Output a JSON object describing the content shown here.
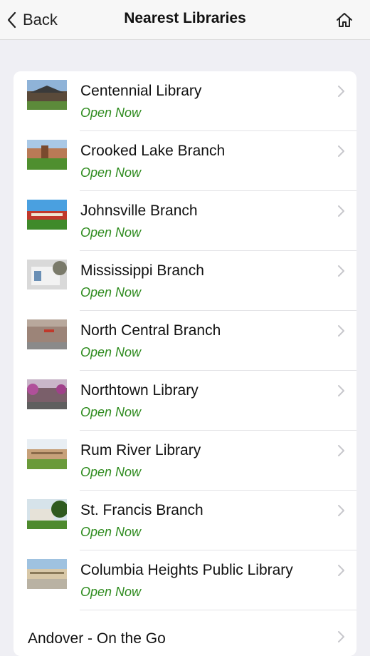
{
  "nav": {
    "back_label": "Back",
    "title": "Nearest Libraries",
    "home_icon": "home-icon"
  },
  "libraries": [
    {
      "name": "Centennial Library",
      "status": "Open Now"
    },
    {
      "name": "Crooked Lake Branch",
      "status": "Open Now"
    },
    {
      "name": "Johnsville Branch",
      "status": "Open Now"
    },
    {
      "name": "Mississippi Branch",
      "status": "Open Now"
    },
    {
      "name": "North Central Branch",
      "status": "Open Now"
    },
    {
      "name": "Northtown Library",
      "status": "Open Now"
    },
    {
      "name": "Rum River Library",
      "status": "Open Now"
    },
    {
      "name": "St. Francis Branch",
      "status": "Open Now"
    },
    {
      "name": "Columbia Heights Public Library",
      "status": "Open Now"
    }
  ],
  "extra_item": {
    "name": "Andover - On the Go"
  },
  "colors": {
    "status_green": "#2e8b1e",
    "background": "#efeff4"
  }
}
